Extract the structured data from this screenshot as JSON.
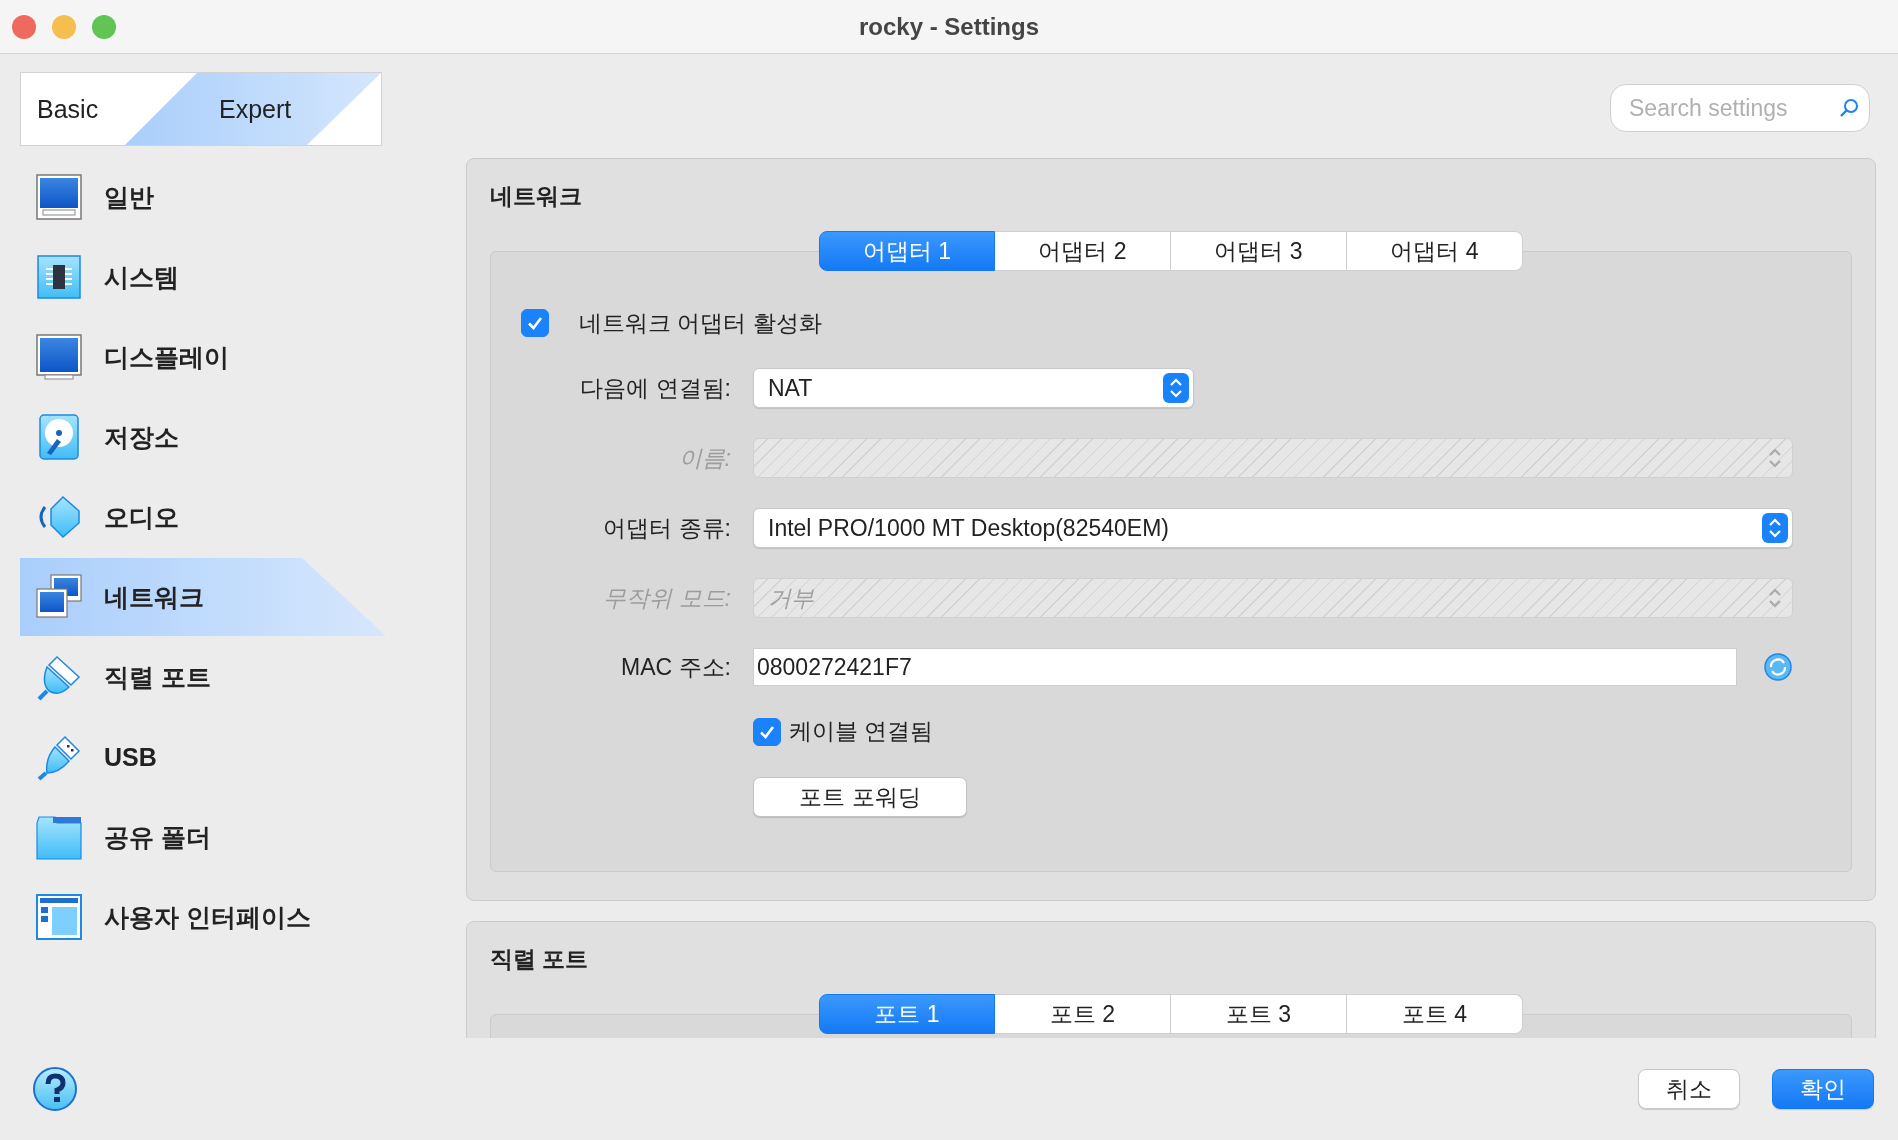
{
  "window": {
    "title": "rocky - Settings"
  },
  "mode_switch": [
    {
      "label": "Basic",
      "selected": false
    },
    {
      "label": "Expert",
      "selected": true
    }
  ],
  "search": {
    "placeholder": "Search settings"
  },
  "sidebar": {
    "items": [
      {
        "label": "일반",
        "kind": "general",
        "selected": false
      },
      {
        "label": "시스템",
        "kind": "system",
        "selected": false
      },
      {
        "label": "디스플레이",
        "kind": "display",
        "selected": false
      },
      {
        "label": "저장소",
        "kind": "storage",
        "selected": false
      },
      {
        "label": "오디오",
        "kind": "audio",
        "selected": false
      },
      {
        "label": "네트워크",
        "kind": "network",
        "selected": true
      },
      {
        "label": "직렬 포트",
        "kind": "serial",
        "selected": false
      },
      {
        "label": "USB",
        "kind": "usb",
        "selected": false
      },
      {
        "label": "공유 폴더",
        "kind": "shared",
        "selected": false
      },
      {
        "label": "사용자 인터페이스",
        "kind": "interface",
        "selected": false
      }
    ]
  },
  "sections": [
    {
      "title": "네트워크",
      "tabs": [
        {
          "label": "어댑터 1",
          "selected": true
        },
        {
          "label": "어댑터 2",
          "selected": false
        },
        {
          "label": "어댑터 3",
          "selected": false
        },
        {
          "label": "어댑터 4",
          "selected": false
        }
      ],
      "rows": [
        {
          "kind": "checkbox",
          "label": "네트워크 어댑터 활성화",
          "checked": true
        },
        {
          "kind": "select",
          "label": "다음에 연결됨:",
          "value": "NAT",
          "disabled": false,
          "wide": false
        },
        {
          "kind": "select",
          "label": "이름:",
          "disabled": true,
          "wide": true
        },
        {
          "kind": "select",
          "label": "어댑터 종류:",
          "value": "Intel PRO/1000 MT Desktop(82540EM)",
          "disabled": false,
          "wide": true
        },
        {
          "kind": "select",
          "label": "무작위 모드:",
          "value": "거부",
          "disabled": true,
          "wide": true
        },
        {
          "kind": "text",
          "label": "MAC 주소:",
          "value": "0800272421F7"
        },
        {
          "kind": "option",
          "label": "케이블 연결됨",
          "checked": true
        },
        {
          "kind": "button",
          "label": "포트 포워딩"
        }
      ]
    },
    {
      "title": "직렬 포트",
      "tabs": [
        {
          "label": "포트 1",
          "selected": true
        },
        {
          "label": "포트 2",
          "selected": false
        },
        {
          "label": "포트 3",
          "selected": false
        },
        {
          "label": "포트 4",
          "selected": false
        }
      ]
    }
  ],
  "buttons": [
    {
      "label": "취소",
      "kind": "default"
    },
    {
      "label": "확인",
      "kind": "primary"
    }
  ]
}
